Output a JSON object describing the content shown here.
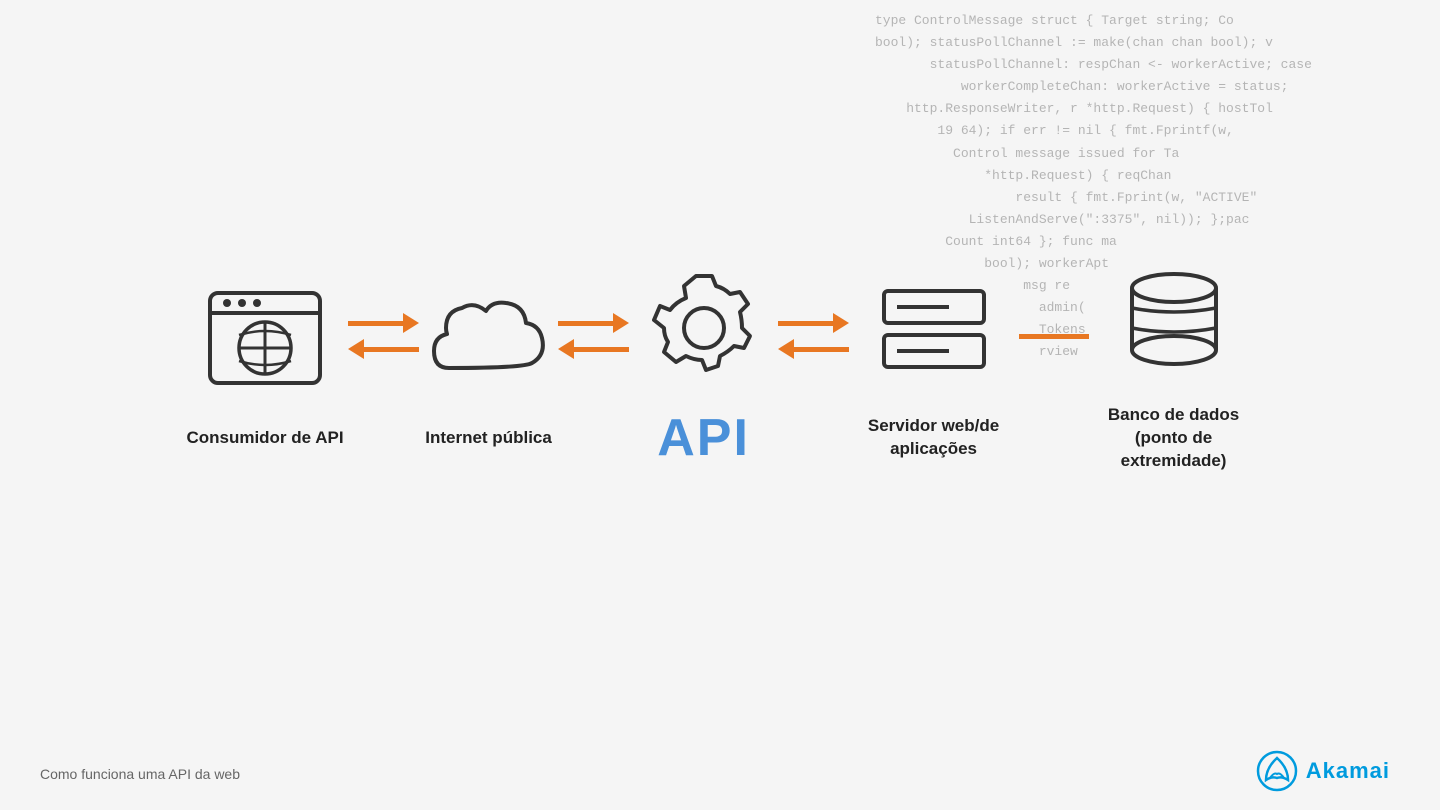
{
  "code_bg": {
    "lines": [
      "type ControlMessage struct { Target string; Co",
      "bool); statusPollChannel := make(chan chan bool); v",
      "statusPollChannel: respChan <- workerActive; case",
      "workerCompleteChan: workerActive = status;",
      "http.ResponseWriter, r *http.Request) { hostTol",
      "19 64); if err != nil { fmt.Fprintf(w,",
      "Control message issued for Ta",
      "*http.Request) { reqChan",
      "result { fmt.Fprint(w, \"ACTIVE\"",
      "ListenAndServe(\":3375\", nil)); };pac",
      "Count int64 }; func ma",
      "bool); workerApt",
      "msg re",
      "admin(",
      "Tokens",
      "rview"
    ]
  },
  "components": [
    {
      "id": "consumer",
      "label": "Consumidor de API",
      "icon_type": "browser"
    },
    {
      "id": "internet",
      "label": "Internet pública",
      "icon_type": "cloud"
    },
    {
      "id": "api",
      "label": "API",
      "icon_type": "gear"
    },
    {
      "id": "server",
      "label": "Servidor web/de aplicações",
      "icon_type": "server"
    },
    {
      "id": "database",
      "label": "Banco de dados (ponto de extremidade)",
      "icon_type": "database"
    }
  ],
  "arrows": [
    {
      "id": "arrow1",
      "type": "double"
    },
    {
      "id": "arrow2",
      "type": "double"
    },
    {
      "id": "arrow3",
      "type": "double"
    },
    {
      "id": "arrow4",
      "type": "single-left"
    }
  ],
  "bottom_caption": "Como funciona uma API da web",
  "akamai_logo_text": "Akamai"
}
